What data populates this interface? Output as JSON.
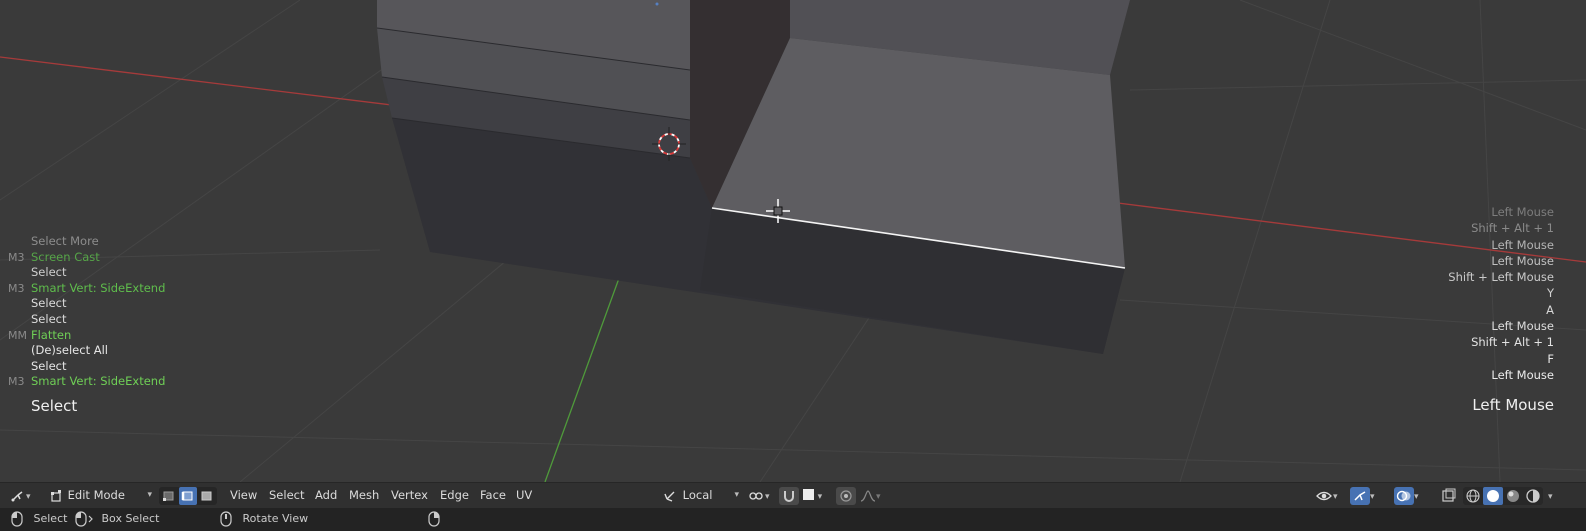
{
  "colors": {
    "viewport_bg": "#3a3a3a",
    "grid": "#454545",
    "axis_x": "#a63a3a",
    "axis_y": "#4f9a3a",
    "mesh_top": "#5e5d61",
    "mesh_side": "#2f2f33",
    "mesh_inner_wall": "#332f30",
    "log_grey": "#8d8d8d",
    "log_white": "#e6e6e6",
    "log_green": "#6fcf56",
    "accent_blue": "#5680c2"
  },
  "left_log": [
    {
      "key": "",
      "text": "Select More",
      "tone": "grey"
    },
    {
      "key": "M3",
      "text": "Screen Cast",
      "tone": "green"
    },
    {
      "key": "",
      "text": "Select",
      "tone": "white"
    },
    {
      "key": "M3",
      "text": "Smart Vert: SideExtend",
      "tone": "green"
    },
    {
      "key": "",
      "text": "Select",
      "tone": "white"
    },
    {
      "key": "",
      "text": "Select",
      "tone": "white"
    },
    {
      "key": "MM",
      "text": "Flatten",
      "tone": "green"
    },
    {
      "key": "",
      "text": "(De)select All",
      "tone": "white"
    },
    {
      "key": "",
      "text": "Select",
      "tone": "white"
    },
    {
      "key": "M3",
      "text": "Smart Vert: SideExtend",
      "tone": "green"
    }
  ],
  "last_operation": "Select",
  "right_log": [
    {
      "text": "Left Mouse",
      "tone": "grey"
    },
    {
      "text": "Shift + Alt + 1",
      "tone": "grey"
    },
    {
      "text": "Left Mouse",
      "tone": "white"
    },
    {
      "text": "Left Mouse",
      "tone": "white"
    },
    {
      "text": "Shift + Left Mouse",
      "tone": "white"
    },
    {
      "text": "Y",
      "tone": "white"
    },
    {
      "text": "A",
      "tone": "white"
    },
    {
      "text": "Left Mouse",
      "tone": "white"
    },
    {
      "text": "Shift + Alt + 1",
      "tone": "white"
    },
    {
      "text": "F",
      "tone": "white"
    },
    {
      "text": "Left Mouse",
      "tone": "white"
    }
  ],
  "last_key": "Left Mouse",
  "header": {
    "editor_type_icon": "editor-type-icon",
    "mode": "Edit Mode",
    "select_modes": [
      "vertex-select-icon",
      "edge-select-icon",
      "face-select-icon"
    ],
    "active_select_mode": 1,
    "menus": [
      "View",
      "Select",
      "Add",
      "Mesh",
      "Vertex",
      "Edge",
      "Face",
      "UV"
    ],
    "transform_orientation": "Local",
    "pivot_icon": "pivot-point-icon",
    "snap_icon": "snap-magnet-icon",
    "proportional_icon": "proportional-edit-icon",
    "falloff_icon": "falloff-curve-icon",
    "right_icons": [
      "visibility-eye-icon",
      "gizmo-icon",
      "overlays-icon",
      "xray-icon",
      "wireframe-shading-icon",
      "solid-shading-icon",
      "material-shading-icon",
      "rendered-shading-icon"
    ]
  },
  "statusbar": {
    "left_click": "Select",
    "box_select": "Box Select",
    "rotate_view": "Rotate View"
  }
}
